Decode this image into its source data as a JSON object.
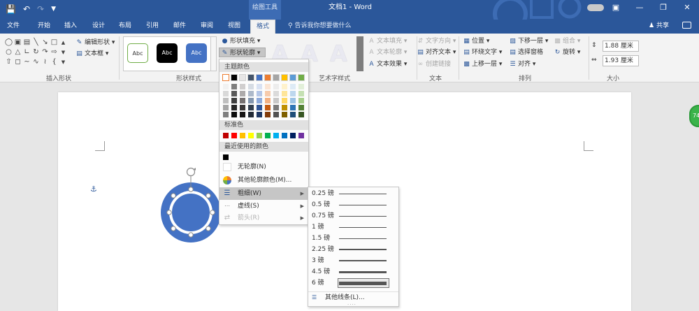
{
  "window": {
    "context_group": "绘图工具",
    "doc_title": "文档1 - Word",
    "qat": {
      "save_icon": "save-icon",
      "undo_icon": "undo-icon",
      "redo_icon": "redo-icon",
      "customize_icon": "customize-qat-icon"
    }
  },
  "tabs": [
    "文件",
    "开始",
    "插入",
    "设计",
    "布局",
    "引用",
    "邮件",
    "审阅",
    "视图",
    "格式"
  ],
  "active_tab": "格式",
  "tell_me": "告诉我你想要做什么",
  "share": "共享",
  "ribbon": {
    "insert_shapes": {
      "label": "插入形状",
      "edit_shape": "编辑形状",
      "text_box": "文本框"
    },
    "shape_styles": {
      "label": "形状样式",
      "sample": "Abc",
      "fill": "形状填充",
      "outline": "形状轮廓"
    },
    "wordart": {
      "label": "艺术字样式",
      "letter": "A",
      "text_fill": "文本填充",
      "text_outline": "文本轮廓",
      "text_effects": "文本效果"
    },
    "text": {
      "label": "文本",
      "direction": "文字方向",
      "align": "对齐文本",
      "link": "创建链接"
    },
    "arrange": {
      "label": "排列",
      "position": "位置",
      "wrap": "环绕文字",
      "forward": "上移一层",
      "backward": "下移一层",
      "selection_pane": "选择窗格",
      "align": "对齐",
      "group": "组合",
      "rotate": "旋转"
    },
    "size": {
      "label": "大小",
      "height": "1.88 厘米",
      "width": "1.93 厘米"
    }
  },
  "outline_menu": {
    "theme_colors": "主题颜色",
    "standard_colors": "标准色",
    "recent_colors": "最近使用的颜色",
    "no_outline": "无轮廓(N)",
    "more_colors": "其他轮廓颜色(M)...",
    "weight": "粗细(W)",
    "dashes": "虚线(S)",
    "arrows": "箭头(R)",
    "theme_base": [
      "#ffffff",
      "#000000",
      "#e7e6e6",
      "#44546a",
      "#4472c4",
      "#ed7d31",
      "#a5a5a5",
      "#ffc000",
      "#5b9bd5",
      "#70ad47"
    ],
    "theme_shades": [
      [
        "#f2f2f2",
        "#d9d9d9",
        "#bfbfbf",
        "#a6a6a6",
        "#7f7f7f"
      ],
      [
        "#7f7f7f",
        "#595959",
        "#3f3f3f",
        "#262626",
        "#0d0d0d"
      ],
      [
        "#d0cece",
        "#aeabab",
        "#767171",
        "#3b3838",
        "#171616"
      ],
      [
        "#d6dce4",
        "#adb9ca",
        "#8497b0",
        "#333f4f",
        "#222a35"
      ],
      [
        "#d9e2f3",
        "#b4c6e7",
        "#8eaadb",
        "#2f5496",
        "#1f3864"
      ],
      [
        "#fbe5d5",
        "#f7cbac",
        "#f4b183",
        "#c55a11",
        "#833c0b"
      ],
      [
        "#ededed",
        "#dbdbdb",
        "#c9c9c9",
        "#7b7b7b",
        "#525252"
      ],
      [
        "#fff2cc",
        "#fee599",
        "#ffd965",
        "#bf9000",
        "#7f6000"
      ],
      [
        "#deebf6",
        "#bdd7ee",
        "#9cc3e5",
        "#2e75b5",
        "#1e4e79"
      ],
      [
        "#e2efd9",
        "#c5e0b3",
        "#a8d08d",
        "#538135",
        "#375623"
      ]
    ],
    "standard": [
      "#c00000",
      "#ff0000",
      "#ffc000",
      "#ffff00",
      "#92d050",
      "#00b050",
      "#00b0f0",
      "#0070c0",
      "#002060",
      "#7030a0"
    ],
    "recent": [
      "#000000"
    ]
  },
  "weight_menu": {
    "items": [
      {
        "label": "0.25 磅",
        "weight": 0.25
      },
      {
        "label": "0.5 磅",
        "weight": 0.5
      },
      {
        "label": "0.75 磅",
        "weight": 0.75
      },
      {
        "label": "1 磅",
        "weight": 1
      },
      {
        "label": "1.5 磅",
        "weight": 1.5
      },
      {
        "label": "2.25 磅",
        "weight": 2.25
      },
      {
        "label": "3 磅",
        "weight": 3
      },
      {
        "label": "4.5 磅",
        "weight": 4.5
      },
      {
        "label": "6 磅",
        "weight": 6
      }
    ],
    "selected_index": 8,
    "more": "其他线条(L)..."
  },
  "document": {
    "shape_fill": "#4472c4",
    "shape_outline": "#ffffff"
  },
  "side_badge": "74"
}
